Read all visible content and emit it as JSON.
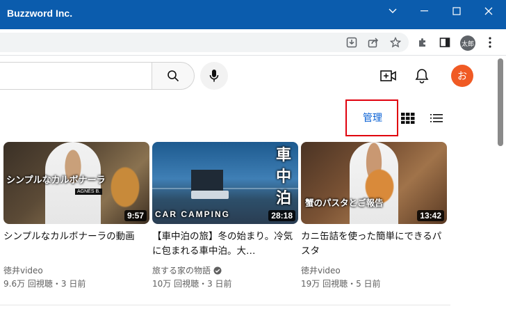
{
  "window": {
    "title": "Buzzword Inc.",
    "controls": [
      "chevron-down",
      "minimize",
      "maximize",
      "close"
    ]
  },
  "toolbar": {
    "profile_initials": "太郎",
    "icons": [
      "install-icon",
      "share-icon",
      "star-icon",
      "extensions-icon",
      "sidepanel-icon",
      "menu-icon"
    ]
  },
  "header": {
    "avatar_letter": "お",
    "icons": [
      "create-video-icon",
      "bell-icon"
    ]
  },
  "manage": {
    "label": "管理"
  },
  "videos": [
    {
      "thumb_text": "シンプルなカルボナーラ",
      "shirt_text": "AGNÈS B.",
      "duration": "9:57",
      "title": "シンプルなカルボナーラの動画",
      "channel": "徳井video",
      "verified": false,
      "meta": "9.6万 回視聴・3 日前"
    },
    {
      "thumb_caption": "CAR CAMPING",
      "thumb_vertical": "車中泊",
      "duration": "28:18",
      "title": "【車中泊の旅】冬の始まり。冷気に包まれる車中泊。大…",
      "channel": "旅する家の物語",
      "verified": true,
      "meta": "10万 回視聴・3 日前"
    },
    {
      "thumb_text": "蟹のパスタとご報告",
      "duration": "13:42",
      "title": "カニ缶詰を使った簡単にできるパスタ",
      "channel": "徳井video",
      "verified": false,
      "meta": "19万 回視聴・5 日前"
    }
  ],
  "colors": {
    "titlebar": "#0b5cad",
    "highlight": "#e0000d",
    "link": "#065fd4",
    "avatar": "#f05a24"
  }
}
